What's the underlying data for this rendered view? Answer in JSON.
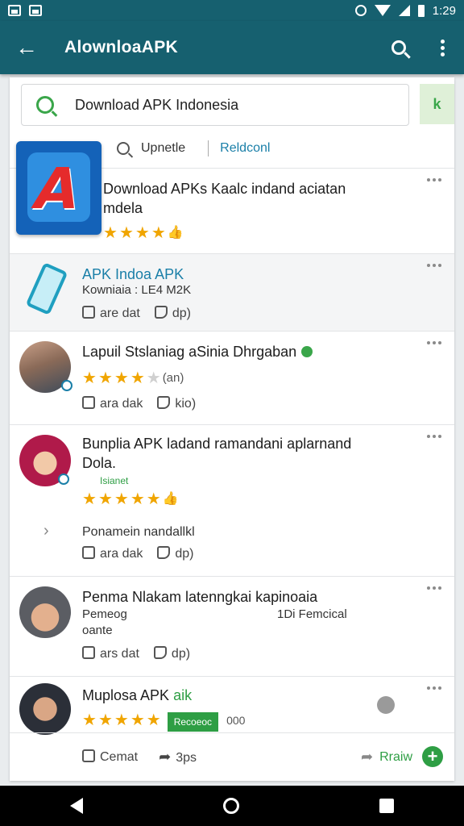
{
  "status_bar": {
    "time": "1:29"
  },
  "app_bar": {
    "title": "AlownloaAPK"
  },
  "search": {
    "value": "Download APK Indonesia",
    "go_label": "k"
  },
  "filters": {
    "sort_label": "Upnetle",
    "relevance_label": "Reldconl"
  },
  "results": [
    {
      "title": "Download APKs Kaalc indand aciatan",
      "title_line2": "mdela",
      "rating": 4,
      "icon": "apk-app-icon"
    },
    {
      "title": "APK Indoa APK",
      "subtitle": "Kowniaia : LE4 M2K",
      "like_label": "are dat",
      "dislike_label": "dp)",
      "icon": "phone-icon"
    }
  ],
  "reviews": [
    {
      "author_line": "Lapuil Stslaniag aSinia Dhrgaban",
      "rating": 4,
      "rating_extra": "(an)",
      "like_label": "ara dak",
      "dislike_label": "kio)",
      "avatar": "user-avatar-street"
    },
    {
      "author_line": "Bunplia APK ladand ramandani aplarnand",
      "author_line2": "Dola.",
      "tag": "Isianet",
      "rating": 5,
      "expand_text": "Ponamein nandallkl",
      "like_label": "ara dak",
      "dislike_label": "dp)",
      "avatar": "user-avatar-hijab"
    },
    {
      "author_line": "Penma Nlakam latenngkai kapinoaia",
      "author_line2": "Pemeog",
      "author_line3": "oante",
      "right_note": "1Di Femcical",
      "like_label": "ars dat",
      "dislike_label": "dp)",
      "avatar": "user-avatar-man"
    },
    {
      "author_line": "Muplosa APK",
      "highlight": "aik",
      "rating": 5,
      "pill": "Recoeoc",
      "count": "000",
      "avatar": "user-avatar-suit"
    }
  ],
  "bottom_bar": {
    "comment_label": "Cemat",
    "share_label": "3ps",
    "review_label": "Rraiw",
    "fab_label": "+"
  }
}
